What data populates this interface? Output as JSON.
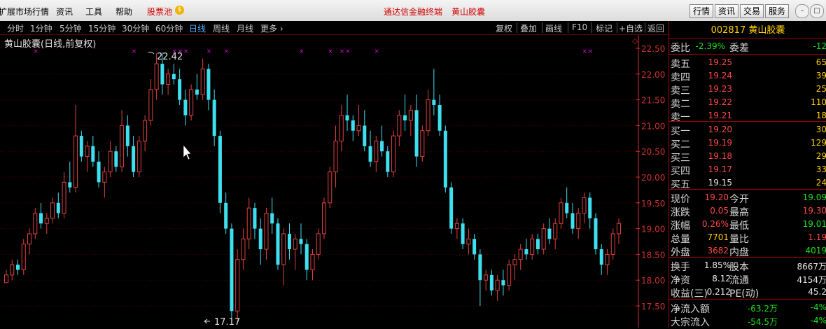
{
  "menu": {
    "items": [
      "扩展市场行情",
      "资讯",
      "工具",
      "帮助",
      "股票池"
    ],
    "app_title": "通达信金融终端",
    "stock_title": "黄山胶囊",
    "right_buttons": [
      "行情",
      "资讯",
      "交易",
      "服务"
    ]
  },
  "period_toolbar": {
    "periods": [
      "分时",
      "1分钟",
      "5分钟",
      "15分钟",
      "30分钟",
      "60分钟",
      "日线",
      "周线",
      "月线",
      "更多 ›"
    ],
    "active": "日线",
    "right_items": [
      "复权",
      "叠加",
      "画线",
      "F10",
      "标记",
      "+自选",
      "返回"
    ]
  },
  "chart": {
    "label": "黄山胶囊(日线,前复权)",
    "price_ticks": [
      "22.50",
      "22.00",
      "21.50",
      "21.00",
      "20.50",
      "20.00",
      "19.50",
      "19.00",
      "18.50",
      "18.00",
      "17.50"
    ],
    "high_annotation": "22.42",
    "low_annotation": "17.17",
    "colors": {
      "up": "#e04040",
      "down": "#3ee0f0",
      "tick": "#d03030",
      "grid": "#5a0000",
      "marker": "#e000e0"
    }
  },
  "chart_data": {
    "type": "candlestick",
    "y_range": [
      17.5,
      22.5
    ],
    "candles": [
      [
        17.95,
        18.2,
        18.0,
        18.1
      ],
      [
        18.1,
        18.4,
        18.0,
        18.3
      ],
      [
        18.3,
        18.4,
        18.1,
        18.2
      ],
      [
        18.2,
        18.8,
        18.1,
        18.7
      ],
      [
        18.7,
        19.0,
        18.5,
        18.9
      ],
      [
        18.9,
        19.4,
        18.8,
        19.3
      ],
      [
        19.3,
        19.5,
        19.0,
        19.1
      ],
      [
        19.1,
        19.3,
        18.9,
        19.2
      ],
      [
        19.2,
        19.6,
        19.1,
        19.5
      ],
      [
        19.5,
        19.7,
        19.2,
        19.3
      ],
      [
        19.3,
        20.1,
        19.2,
        19.9
      ],
      [
        19.9,
        20.3,
        19.7,
        19.8
      ],
      [
        19.8,
        21.4,
        19.7,
        20.8
      ],
      [
        20.8,
        20.9,
        20.3,
        20.4
      ],
      [
        20.4,
        20.7,
        20.1,
        20.6
      ],
      [
        20.6,
        20.8,
        20.2,
        20.3
      ],
      [
        20.3,
        20.5,
        19.8,
        19.9
      ],
      [
        19.9,
        20.2,
        19.6,
        20.1
      ],
      [
        20.1,
        20.7,
        20.0,
        20.5
      ],
      [
        20.5,
        20.6,
        20.1,
        20.2
      ],
      [
        20.2,
        21.3,
        20.1,
        21.0
      ],
      [
        21.0,
        21.2,
        20.4,
        20.6
      ],
      [
        20.6,
        20.8,
        20.0,
        20.1
      ],
      [
        20.1,
        20.8,
        20.0,
        20.7
      ],
      [
        20.7,
        21.2,
        20.5,
        21.1
      ],
      [
        21.1,
        21.9,
        21.0,
        21.7
      ],
      [
        21.7,
        22.4,
        21.5,
        22.2
      ],
      [
        22.2,
        22.42,
        21.6,
        21.8
      ],
      [
        21.8,
        22.1,
        21.6,
        22.0
      ],
      [
        22.0,
        22.2,
        21.8,
        21.9
      ],
      [
        21.9,
        22.1,
        21.4,
        21.5
      ],
      [
        21.5,
        21.7,
        21.0,
        21.2
      ],
      [
        21.2,
        21.8,
        21.1,
        21.7
      ],
      [
        21.7,
        22.0,
        21.5,
        21.6
      ],
      [
        21.6,
        22.3,
        21.5,
        22.1
      ],
      [
        22.1,
        22.2,
        21.3,
        21.5
      ],
      [
        21.5,
        21.7,
        20.6,
        20.8
      ],
      [
        20.8,
        20.9,
        19.3,
        19.5
      ],
      [
        19.5,
        19.7,
        18.9,
        19.0
      ],
      [
        19.0,
        19.1,
        17.17,
        17.4
      ],
      [
        17.4,
        18.6,
        17.2,
        18.4
      ],
      [
        18.4,
        19.0,
        18.2,
        18.8
      ],
      [
        18.8,
        19.6,
        18.6,
        19.4
      ],
      [
        19.4,
        19.5,
        18.8,
        19.0
      ],
      [
        19.0,
        19.2,
        18.3,
        18.6
      ],
      [
        18.6,
        19.4,
        18.4,
        19.3
      ],
      [
        19.3,
        19.6,
        18.9,
        19.1
      ],
      [
        19.1,
        19.2,
        18.2,
        18.3
      ],
      [
        18.3,
        19.0,
        17.9,
        18.9
      ],
      [
        18.9,
        19.1,
        18.4,
        18.6
      ],
      [
        18.6,
        18.9,
        18.2,
        18.8
      ],
      [
        18.8,
        19.1,
        18.5,
        18.7
      ],
      [
        18.7,
        18.8,
        18.0,
        18.2
      ],
      [
        18.2,
        18.6,
        18.0,
        18.5
      ],
      [
        18.5,
        19.0,
        18.4,
        18.9
      ],
      [
        18.9,
        19.6,
        18.8,
        19.5
      ],
      [
        19.5,
        20.2,
        19.4,
        20.1
      ],
      [
        20.1,
        21.0,
        19.8,
        20.7
      ],
      [
        20.7,
        21.4,
        20.5,
        21.2
      ],
      [
        21.2,
        21.6,
        20.9,
        21.1
      ],
      [
        21.1,
        21.2,
        20.7,
        20.9
      ],
      [
        20.9,
        21.4,
        20.8,
        21.0
      ],
      [
        21.0,
        21.3,
        20.5,
        20.6
      ],
      [
        20.6,
        20.9,
        20.2,
        20.3
      ],
      [
        20.3,
        20.8,
        20.1,
        20.7
      ],
      [
        20.7,
        21.0,
        20.4,
        20.5
      ],
      [
        20.5,
        20.6,
        20.0,
        20.1
      ],
      [
        20.1,
        20.9,
        20.0,
        20.8
      ],
      [
        20.8,
        21.3,
        20.6,
        21.2
      ],
      [
        21.2,
        21.6,
        20.9,
        21.1
      ],
      [
        21.1,
        21.4,
        20.8,
        21.3
      ],
      [
        21.3,
        21.6,
        20.2,
        20.4
      ],
      [
        20.4,
        21.0,
        20.3,
        20.9
      ],
      [
        20.9,
        21.7,
        20.8,
        21.5
      ],
      [
        21.5,
        22.1,
        21.2,
        21.4
      ],
      [
        21.4,
        21.6,
        20.8,
        20.9
      ],
      [
        20.9,
        21.0,
        19.7,
        19.8
      ],
      [
        19.8,
        19.9,
        18.9,
        19.0
      ],
      [
        19.0,
        19.2,
        18.8,
        19.1
      ],
      [
        19.1,
        19.2,
        18.6,
        18.7
      ],
      [
        18.7,
        19.0,
        18.5,
        18.8
      ],
      [
        18.8,
        18.9,
        18.4,
        18.5
      ],
      [
        18.5,
        18.6,
        17.5,
        18.0
      ],
      [
        18.0,
        18.2,
        17.8,
        18.1
      ],
      [
        18.1,
        18.2,
        17.7,
        17.8
      ],
      [
        17.8,
        18.1,
        17.6,
        18.0
      ],
      [
        18.0,
        18.2,
        17.7,
        17.9
      ],
      [
        17.9,
        18.4,
        17.8,
        18.3
      ],
      [
        18.3,
        18.5,
        18.0,
        18.4
      ],
      [
        18.4,
        18.7,
        18.2,
        18.6
      ],
      [
        18.6,
        18.8,
        18.4,
        18.5
      ],
      [
        18.5,
        18.9,
        18.4,
        18.8
      ],
      [
        18.8,
        18.9,
        18.5,
        18.6
      ],
      [
        18.6,
        19.1,
        18.5,
        19.0
      ],
      [
        19.0,
        19.2,
        18.7,
        18.8
      ],
      [
        18.8,
        19.2,
        18.6,
        19.1
      ],
      [
        19.1,
        19.6,
        19.0,
        19.5
      ],
      [
        19.5,
        19.8,
        19.2,
        19.3
      ],
      [
        19.3,
        19.5,
        18.9,
        19.0
      ],
      [
        19.0,
        19.4,
        18.8,
        19.3
      ],
      [
        19.3,
        19.7,
        19.1,
        19.6
      ],
      [
        19.6,
        19.7,
        19.0,
        19.2
      ],
      [
        19.2,
        19.3,
        18.5,
        18.6
      ],
      [
        18.6,
        18.7,
        18.1,
        18.3
      ],
      [
        18.3,
        18.6,
        18.1,
        18.5
      ],
      [
        18.5,
        19.0,
        18.4,
        18.9
      ],
      [
        18.9,
        19.2,
        18.7,
        19.1
      ]
    ],
    "markers_on_candles": [
      5,
      22,
      29,
      30,
      31,
      35,
      38,
      51,
      56,
      58,
      59,
      64,
      100,
      101
    ]
  },
  "quote_panel": {
    "code": "002817",
    "name": "黄山胶囊",
    "committee": {
      "label": "委比",
      "value": "-2.39%",
      "label2": "委差",
      "value2": "-12"
    },
    "sells": [
      {
        "label": "卖五",
        "price": "19.25",
        "vol": "65"
      },
      {
        "label": "卖四",
        "price": "19.24",
        "vol": "39"
      },
      {
        "label": "卖三",
        "price": "19.23",
        "vol": "25"
      },
      {
        "label": "卖二",
        "price": "19.22",
        "vol": "110"
      },
      {
        "label": "卖一",
        "price": "19.21",
        "vol": "18"
      }
    ],
    "buys": [
      {
        "label": "买一",
        "price": "19.20",
        "vol": "30"
      },
      {
        "label": "买二",
        "price": "19.19",
        "vol": "129"
      },
      {
        "label": "买三",
        "price": "19.18",
        "vol": "29"
      },
      {
        "label": "买四",
        "price": "19.17",
        "vol": "33"
      },
      {
        "label": "买五",
        "price": "19.15",
        "vol": "24"
      }
    ],
    "stats1": [
      {
        "l1": "现价",
        "v1": "19.20",
        "c1": "red",
        "l2": "今开",
        "v2": "19.09",
        "c2": "green"
      },
      {
        "l1": "涨跌",
        "v1": "0.05",
        "c1": "red",
        "l2": "最高",
        "v2": "19.30",
        "c2": "red"
      },
      {
        "l1": "涨幅",
        "v1": "0.26%",
        "c1": "red",
        "l2": "最低",
        "v2": "19.01",
        "c2": "green"
      },
      {
        "l1": "总量",
        "v1": "7701",
        "c1": "yellow",
        "l2": "量比",
        "v2": "1.19",
        "c2": "red"
      },
      {
        "l1": "外盘",
        "v1": "3682",
        "c1": "red",
        "l2": "内盘",
        "v2": "4019",
        "c2": "green"
      }
    ],
    "stats2": [
      {
        "l1": "换手",
        "v1": "1.85%",
        "l2": "股本",
        "v2": "8667万"
      },
      {
        "l1": "净资",
        "v1": "8.12",
        "l2": "流通",
        "v2": "4154万"
      },
      {
        "l1": "收益(三)",
        "v1": "0.212",
        "l2": "PE(动)",
        "v2": "45.2"
      }
    ],
    "flows": [
      {
        "label": "净流入额",
        "value": "-63.2万",
        "pct": "-4%"
      },
      {
        "label": "大宗流入",
        "value": "-54.5万",
        "pct": "-4%"
      }
    ]
  }
}
